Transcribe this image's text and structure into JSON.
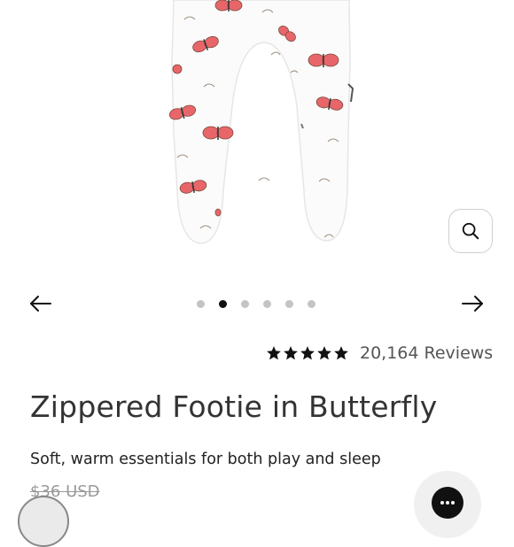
{
  "gallery": {
    "image_alt": "Zippered Footie in Butterfly product photo",
    "total_slides": 6,
    "active_slide": 2
  },
  "rating": {
    "stars": 5,
    "reviews_label": "20,164 Reviews"
  },
  "product": {
    "title": "Zippered Footie in Butterfly",
    "subtitle": "Soft, warm essentials for both play and sleep",
    "price": "$36 USD"
  },
  "icons": {
    "zoom": "search-icon",
    "prev": "arrow-left-icon",
    "next": "arrow-right-icon",
    "chat": "chat-icon",
    "star": "star-icon"
  },
  "colors": {
    "background": "#ffffff",
    "dot_active": "#111111",
    "dot_inactive": "#c4c4c4",
    "star": "#111111",
    "price_muted": "#999999",
    "butterfly": "#e8666a"
  }
}
